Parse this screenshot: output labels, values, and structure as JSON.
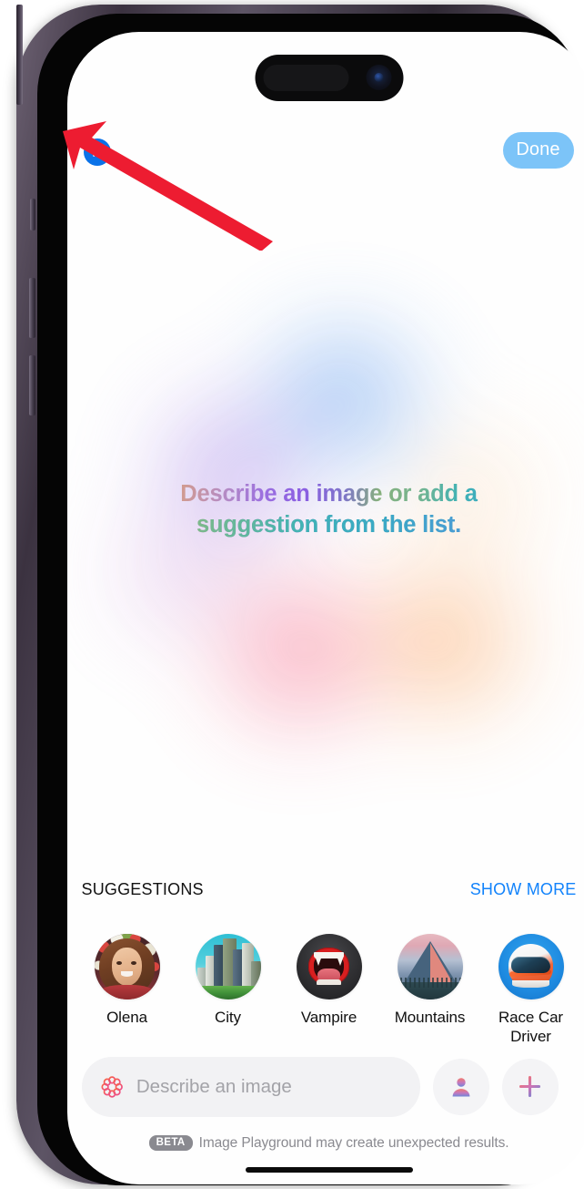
{
  "device": {
    "type": "iphone-15-pro",
    "frame_color": "#4a4150",
    "dynamic_island": true,
    "home_indicator": true
  },
  "topbar": {
    "close_label": "close",
    "close_icon": "x-circle-icon",
    "close_color": "#0a72e8",
    "done_label": "Done",
    "done_bg": "#7cc4f8",
    "done_text_color": "#ffffff"
  },
  "main": {
    "prompt_line_1": "Describe an image or add a",
    "prompt_line_2": "suggestion from the list.",
    "prompt_gradient": [
      "#e9a45e",
      "#9b6fe0",
      "#41b2b4",
      "#5a9ad8"
    ],
    "ambient_blob_colors": [
      "#78aaf0",
      "#b296eb",
      "#f88ca5",
      "#fcb278"
    ]
  },
  "suggestions": {
    "title": "SUGGESTIONS",
    "show_more_label": "SHOW MORE",
    "show_more_color": "#1283fb",
    "items": [
      {
        "label": "Olena",
        "icon": "portrait-thumbnail"
      },
      {
        "label": "City",
        "icon": "cityscape-thumbnail"
      },
      {
        "label": "Vampire",
        "icon": "vampire-mouth-thumbnail"
      },
      {
        "label": "Mountains",
        "icon": "mountain-thumbnail"
      },
      {
        "label": "Race Car Driver",
        "icon": "racing-helmet-thumbnail"
      }
    ]
  },
  "composer": {
    "placeholder": "Describe an image",
    "value": "",
    "sparkle_icon": "apple-intelligence-icon",
    "person_button_icon": "person-icon",
    "add_button_icon": "plus-icon"
  },
  "footer": {
    "beta_badge": "BETA",
    "disclaimer": "Image Playground may create unexpected results."
  },
  "annotation": {
    "arrow_color": "#ed1c31",
    "arrow_target": "close-button"
  }
}
